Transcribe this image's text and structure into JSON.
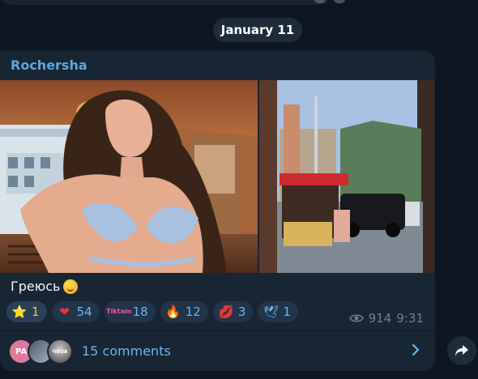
{
  "date_separator": "January 11",
  "message": {
    "sender": "Rochersha",
    "caption": "Греюсь",
    "caption_emoji": "face-with-hand-over-mouth",
    "reactions": [
      {
        "icon": "star-icon",
        "glyph": "⭐",
        "count": "1",
        "selected": true
      },
      {
        "icon": "heart-icon",
        "glyph": "❤",
        "count": "54"
      },
      {
        "icon": "sticker-text-icon",
        "glyph": "Tiktam",
        "count": "18"
      },
      {
        "icon": "fire-icon",
        "glyph": "🔥",
        "count": "12"
      },
      {
        "icon": "kiss-icon",
        "glyph": "💋",
        "count": "3"
      },
      {
        "icon": "dove-icon",
        "glyph": "🕊",
        "count": "1"
      }
    ],
    "views": "914",
    "time": "9:31",
    "comments": {
      "label": "15 comments",
      "avatars": [
        {
          "initials": "PA",
          "color": "#e07a9a"
        },
        {
          "initials": ""
        },
        {
          "initials": "ЧВОА"
        }
      ]
    }
  },
  "colors": {
    "background": "#0e1621",
    "bubble": "#182533",
    "accent": "#6ab8f0",
    "sender": "#5ea7de"
  }
}
